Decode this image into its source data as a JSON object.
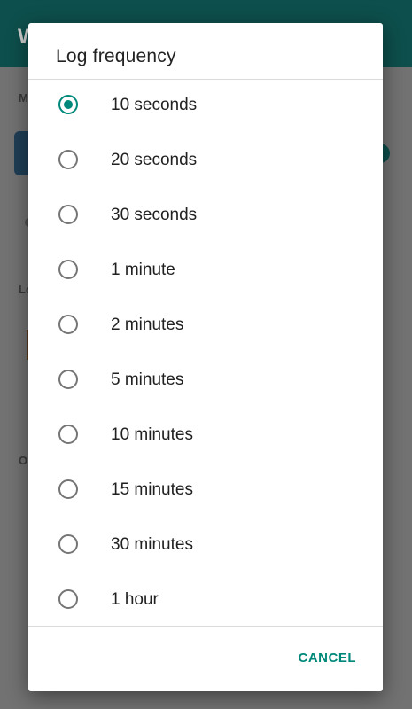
{
  "background": {
    "app_title_fragment": "W",
    "section_fragment_1": "M",
    "section_fragment_2": "Lo",
    "section_fragment_3": "O"
  },
  "dialog": {
    "title": "Log frequency",
    "selected_index": 0,
    "options": [
      {
        "label": "10 seconds",
        "checked": true
      },
      {
        "label": "20 seconds",
        "checked": false
      },
      {
        "label": "30 seconds",
        "checked": false
      },
      {
        "label": "1 minute",
        "checked": false
      },
      {
        "label": "2 minutes",
        "checked": false
      },
      {
        "label": "5 minutes",
        "checked": false
      },
      {
        "label": "10 minutes",
        "checked": false
      },
      {
        "label": "15 minutes",
        "checked": false
      },
      {
        "label": "30 minutes",
        "checked": false
      },
      {
        "label": "1 hour",
        "checked": false
      }
    ],
    "cancel_label": "CANCEL"
  },
  "colors": {
    "accent": "#00897b",
    "app_bar": "#0d4f4c",
    "scrim": "#727272",
    "radio_unchecked": "#757575"
  }
}
